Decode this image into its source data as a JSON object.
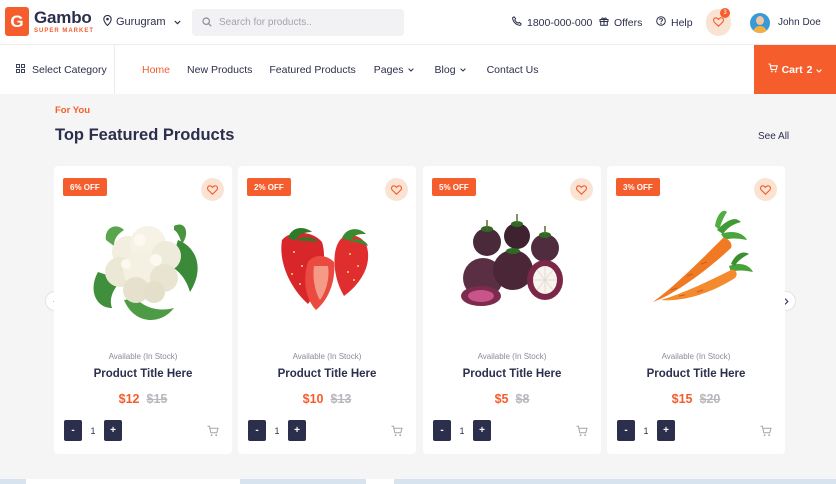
{
  "brand": {
    "letter": "G",
    "name": "Gambo",
    "sub": "SUPER MARKET"
  },
  "header": {
    "location": "Gurugram",
    "search_placeholder": "Search for products..",
    "phone": "1800-000-000",
    "offers": "Offers",
    "help": "Help",
    "wishlist_count": "3",
    "user_name": "John Doe"
  },
  "nav": {
    "select_category": "Select Category",
    "items": [
      "Home",
      "New Products",
      "Featured Products",
      "Pages",
      "Blog",
      "Contact Us"
    ],
    "cart_label": "Cart",
    "cart_count": "2"
  },
  "section": {
    "eyebrow": "For You",
    "title": "Top Featured Products",
    "see_all": "See All"
  },
  "products": [
    {
      "discount": "6% OFF",
      "image": "cauliflower",
      "availability": "Available (In Stock)",
      "title": "Product Title Here",
      "price": "$12",
      "old_price": "$15",
      "qty": "1"
    },
    {
      "discount": "2% OFF",
      "image": "strawberries",
      "availability": "Available (In Stock)",
      "title": "Product Title Here",
      "price": "$10",
      "old_price": "$13",
      "qty": "1"
    },
    {
      "discount": "5% OFF",
      "image": "mangosteen",
      "availability": "Available (In Stock)",
      "title": "Product Title Here",
      "price": "$5",
      "old_price": "$8",
      "qty": "1"
    },
    {
      "discount": "3% OFF",
      "image": "carrots",
      "availability": "Available (In Stock)",
      "title": "Product Title Here",
      "price": "$15",
      "old_price": "$20",
      "qty": "1"
    }
  ],
  "qty_controls": {
    "minus": "-",
    "plus": "+"
  },
  "colors": {
    "accent": "#f55d2c",
    "dark": "#2b2f4c",
    "accent_light": "#fbe3d3"
  }
}
